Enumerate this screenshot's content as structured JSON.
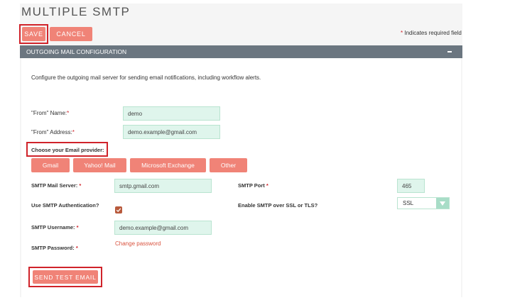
{
  "page": {
    "title": "MULTIPLE SMTP"
  },
  "toolbar": {
    "save_label": "SAVE",
    "cancel_label": "CANCEL",
    "required_note": "Indicates required field",
    "required_star": "*"
  },
  "section": {
    "title": "OUTGOING MAIL CONFIGURATION",
    "collapse_icon": "minus-icon",
    "description": "Configure the outgoing mail server for sending email notifications, including workflow alerts."
  },
  "form": {
    "from_name": {
      "label": "\"From\" Name:",
      "value": "demo"
    },
    "from_address": {
      "label": "\"From\" Address:",
      "value": "demo.example@gmail.com"
    },
    "provider_label": "Choose your Email provider:",
    "providers": [
      "Gmail",
      "Yahoo! Mail",
      "Microsoft Exchange",
      "Other"
    ],
    "smtp_server": {
      "label": "SMTP Mail Server:",
      "value": "smtp.gmail.com"
    },
    "smtp_port": {
      "label": "SMTP Port",
      "value": "465"
    },
    "smtp_auth": {
      "label": "Use SMTP Authentication?",
      "checked": true
    },
    "ssl": {
      "label": "Enable SMTP over SSL or TLS?",
      "value": "SSL"
    },
    "username": {
      "label": "SMTP Username:",
      "value": "demo.example@gmail.com"
    },
    "password": {
      "label": "SMTP Password:",
      "link": "Change password"
    },
    "required_star": "*",
    "send_test_label": "SEND TEST EMAIL"
  },
  "colors": {
    "accent": "#f08377",
    "highlight": "#d0232a",
    "header": "#6b7680",
    "input_bg": "#dff5ec"
  }
}
